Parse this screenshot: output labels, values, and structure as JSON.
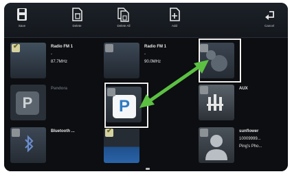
{
  "toolbar": {
    "save": "Save",
    "delete": "Delete",
    "delete_all": "Delete All",
    "add": "Add",
    "cancel": "Cancel"
  },
  "tiles": {
    "radio1": {
      "title": "Radio FM 1",
      "line2": "-",
      "line3": "87.7MHz"
    },
    "radio2": {
      "title": "Radio FM 1",
      "line2": "-",
      "line3": "90.0MHz"
    },
    "pandora": {
      "title": "Pandora"
    },
    "aux": {
      "title": "AUX"
    },
    "bluetooth": {
      "title": "Bluetooth ..."
    },
    "phone": {
      "title": "sunflower",
      "line2": "10009999...",
      "line3": "Ping's Pho..."
    }
  },
  "colors": {
    "accent_green": "#5cc043",
    "pandora_blue": "#2f7bc2",
    "highlight_border": "#f2f2f2"
  }
}
